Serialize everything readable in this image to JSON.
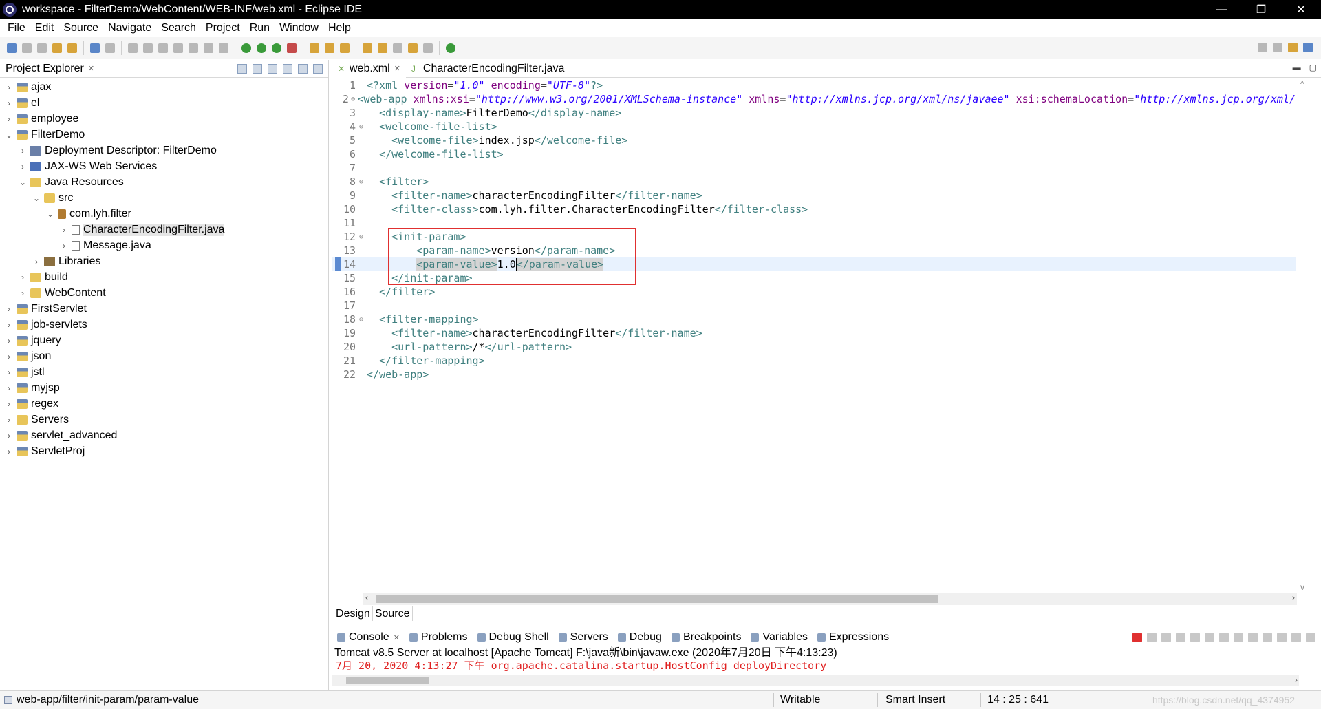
{
  "window": {
    "title": "workspace - FilterDemo/WebContent/WEB-INF/web.xml - Eclipse IDE",
    "minimize": "—",
    "restore": "❐",
    "close": "✕"
  },
  "menu": [
    "File",
    "Edit",
    "Source",
    "Navigate",
    "Search",
    "Project",
    "Run",
    "Window",
    "Help"
  ],
  "explorer": {
    "tab_label": "Project Explorer",
    "items": [
      {
        "label": "ajax",
        "arrow": "›",
        "icon": "project-icon"
      },
      {
        "label": "el",
        "arrow": "›",
        "icon": "project-icon"
      },
      {
        "label": "employee",
        "arrow": "›",
        "icon": "project-icon"
      },
      {
        "label": "FilterDemo",
        "arrow": "⌄",
        "icon": "project-icon"
      },
      {
        "label": "Deployment Descriptor: FilterDemo",
        "arrow": "›",
        "icon": "descriptor-icon"
      },
      {
        "label": "JAX-WS Web Services",
        "arrow": "›",
        "icon": "webservice-icon"
      },
      {
        "label": "Java Resources",
        "arrow": "⌄",
        "icon": "java-resources-icon"
      },
      {
        "label": "src",
        "arrow": "⌄",
        "icon": "source-folder-icon"
      },
      {
        "label": "com.lyh.filter",
        "arrow": "⌄",
        "icon": "package-icon"
      },
      {
        "label": "CharacterEncodingFilter.java",
        "arrow": "›",
        "icon": "java-file-icon",
        "selected": true
      },
      {
        "label": "Message.java",
        "arrow": "›",
        "icon": "java-file-icon"
      },
      {
        "label": "Libraries",
        "arrow": "›",
        "icon": "library-icon"
      },
      {
        "label": "build",
        "arrow": "›",
        "icon": "folder-icon"
      },
      {
        "label": "WebContent",
        "arrow": "›",
        "icon": "folder-icon"
      },
      {
        "label": "FirstServlet",
        "arrow": "›",
        "icon": "project-icon"
      },
      {
        "label": "job-servlets",
        "arrow": "›",
        "icon": "project-icon"
      },
      {
        "label": "jquery",
        "arrow": "›",
        "icon": "project-icon"
      },
      {
        "label": "json",
        "arrow": "›",
        "icon": "project-icon"
      },
      {
        "label": "jstl",
        "arrow": "›",
        "icon": "project-icon"
      },
      {
        "label": "myjsp",
        "arrow": "›",
        "icon": "project-icon"
      },
      {
        "label": "regex",
        "arrow": "›",
        "icon": "project-icon"
      },
      {
        "label": "Servers",
        "arrow": "›",
        "icon": "folder-icon"
      },
      {
        "label": "servlet_advanced",
        "arrow": "›",
        "icon": "project-icon"
      },
      {
        "label": "ServletProj",
        "arrow": "›",
        "icon": "project-icon"
      }
    ]
  },
  "editor": {
    "tabs": [
      {
        "label": "web.xml",
        "active": true
      },
      {
        "label": "CharacterEncodingFilter.java",
        "active": false
      }
    ],
    "lines": [
      {
        "n": "1",
        "fold": "",
        "html": "<span class=\"tag\">&lt;?xml</span> <span class=\"attr\">version</span>=<span class=\"val\">\"1.0\"</span> <span class=\"attr\">encoding</span>=<span class=\"val\">\"UTF-8\"</span><span class=\"tag\">?&gt;</span>"
      },
      {
        "n": "2",
        "fold": "⊖",
        "html": "<span class=\"tag\">&lt;web-app</span> <span class=\"attr\">xmlns:xsi</span>=<span class=\"val\">\"http://www.w3.org/2001/XMLSchema-instance\"</span> <span class=\"attr\">xmlns</span>=<span class=\"val\">\"http://xmlns.jcp.org/xml/ns/javaee\"</span> <span class=\"attr\">xsi:schemaLocation</span>=<span class=\"val\">\"http://xmlns.jcp.org/xml/</span>"
      },
      {
        "n": "3",
        "fold": "",
        "html": "  <span class=\"tag\">&lt;display-name&gt;</span>FilterDemo<span class=\"tag\">&lt;/display-name&gt;</span>"
      },
      {
        "n": "4",
        "fold": "⊖",
        "html": "  <span class=\"tag\">&lt;welcome-file-list&gt;</span>"
      },
      {
        "n": "5",
        "fold": "",
        "html": "    <span class=\"tag\">&lt;welcome-file&gt;</span>index.jsp<span class=\"tag\">&lt;/welcome-file&gt;</span>"
      },
      {
        "n": "6",
        "fold": "",
        "html": "  <span class=\"tag\">&lt;/welcome-file-list&gt;</span>"
      },
      {
        "n": "7",
        "fold": "",
        "html": ""
      },
      {
        "n": "8",
        "fold": "⊖",
        "html": "  <span class=\"tag\">&lt;filter&gt;</span>"
      },
      {
        "n": "9",
        "fold": "",
        "html": "    <span class=\"tag\">&lt;filter-name&gt;</span>characterEncodingFilter<span class=\"tag\">&lt;/filter-name&gt;</span>"
      },
      {
        "n": "10",
        "fold": "",
        "html": "    <span class=\"tag\">&lt;filter-class&gt;</span>com.lyh.filter.CharacterEncodingFilter<span class=\"tag\">&lt;/filter-class&gt;</span>"
      },
      {
        "n": "11",
        "fold": "",
        "html": ""
      },
      {
        "n": "12",
        "fold": "⊖",
        "html": "    <span class=\"tag\">&lt;init-param&gt;</span>"
      },
      {
        "n": "13",
        "fold": "",
        "html": "        <span class=\"tag\">&lt;param-name&gt;</span>version<span class=\"tag\">&lt;/param-name&gt;</span>"
      },
      {
        "n": "14",
        "fold": "",
        "html": "        <span class=\"tag hl\">&lt;param-value&gt;</span>1.0<span class=\"caret\"></span><span class=\"tag hl\">&lt;/param-value&gt;</span>",
        "current": true
      },
      {
        "n": "15",
        "fold": "",
        "html": "    <span class=\"tag\">&lt;/init-param&gt;</span>"
      },
      {
        "n": "16",
        "fold": "",
        "html": "  <span class=\"tag\">&lt;/filter&gt;</span>"
      },
      {
        "n": "17",
        "fold": "",
        "html": ""
      },
      {
        "n": "18",
        "fold": "⊖",
        "html": "  <span class=\"tag\">&lt;filter-mapping&gt;</span>"
      },
      {
        "n": "19",
        "fold": "",
        "html": "    <span class=\"tag\">&lt;filter-name&gt;</span>characterEncodingFilter<span class=\"tag\">&lt;/filter-name&gt;</span>"
      },
      {
        "n": "20",
        "fold": "",
        "html": "    <span class=\"tag\">&lt;url-pattern&gt;</span>/*<span class=\"tag\">&lt;/url-pattern&gt;</span>"
      },
      {
        "n": "21",
        "fold": "",
        "html": "  <span class=\"tag\">&lt;/filter-mapping&gt;</span>"
      },
      {
        "n": "22",
        "fold": "",
        "html": "<span class=\"tag\">&lt;/web-app&gt;</span>"
      }
    ],
    "design_tab": "Design",
    "source_tab": "Source"
  },
  "console": {
    "tabs": [
      "Console",
      "Problems",
      "Debug Shell",
      "Servers",
      "Debug",
      "Breakpoints",
      "Variables",
      "Expressions"
    ],
    "description": "Tomcat v8.5 Server at localhost [Apache Tomcat] F:\\java新\\bin\\javaw.exe  (2020年7月20日 下午4:13:23)",
    "log_line": "7月 20, 2020 4:13:27 下午 org.apache.catalina.startup.HostConfig deployDirectory"
  },
  "status": {
    "path": "web-app/filter/init-param/param-value",
    "mode": "Writable",
    "insert": "Smart Insert",
    "position": "14 : 25 : 641",
    "watermark": "https://blog.csdn.net/qq_4374952"
  }
}
